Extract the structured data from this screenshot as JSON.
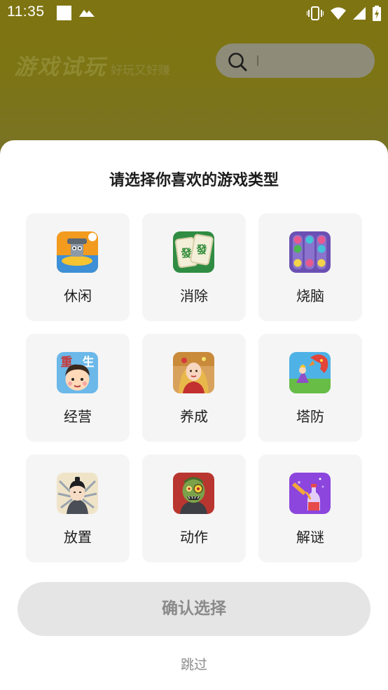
{
  "status_bar": {
    "time": "11:35"
  },
  "header": {
    "brand_title": "游戏试玩",
    "brand_subtitle": "好玩又好赚",
    "search_icon": "search-icon"
  },
  "sheet": {
    "title": "请选择你喜欢的游戏类型",
    "categories": [
      {
        "label": "休闲",
        "icon": "casual-game-icon",
        "color": "#f19a20"
      },
      {
        "label": "消除",
        "icon": "mahjong-game-icon",
        "color": "#2e8a40"
      },
      {
        "label": "烧脑",
        "icon": "sort-puzzle-icon",
        "color": "#6a4fb0"
      },
      {
        "label": "经营",
        "icon": "business-game-icon",
        "color": "#69b7e8"
      },
      {
        "label": "养成",
        "icon": "raising-game-icon",
        "color": "#c84a2f"
      },
      {
        "label": "塔防",
        "icon": "tower-defense-icon",
        "color": "#e24a3a"
      },
      {
        "label": "放置",
        "icon": "idle-game-icon",
        "color": "#e9dcc0"
      },
      {
        "label": "动作",
        "icon": "action-game-icon",
        "color": "#3b6e36"
      },
      {
        "label": "解谜",
        "icon": "puzzle-bottle-icon",
        "color": "#8f46e0"
      }
    ],
    "confirm_label": "确认选择",
    "skip_label": "跳过"
  },
  "colors": {
    "header_bg": "#7e7411",
    "card_bg": "#f5f5f5",
    "confirm_bg": "#e5e5e5",
    "confirm_text": "#8a8a8a"
  }
}
